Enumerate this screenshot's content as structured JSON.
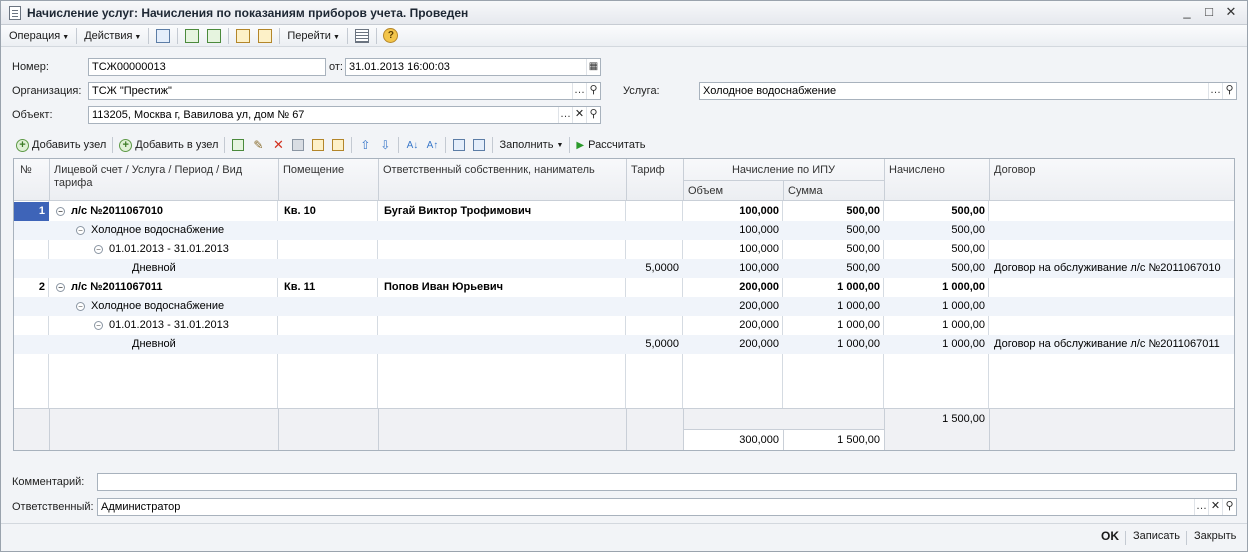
{
  "window": {
    "title": "Начисление услуг: Начисления по показаниям приборов учета. Проведен",
    "controls": [
      "_",
      "□",
      "✕"
    ]
  },
  "toolbar": {
    "operation": "Операция",
    "actions": "Действия",
    "goto": "Перейти"
  },
  "form": {
    "number_label": "Номер:",
    "number_value": "ТСЖ00000013",
    "date_label": "от:",
    "date_value": "31.01.2013 16:00:03",
    "org_label": "Организация:",
    "org_value": "ТСЖ \"Престиж\"",
    "service_label": "Услуга:",
    "service_value": "Холодное водоснабжение",
    "object_label": "Объект:",
    "object_value": "113205, Москва г, Вавилова ул, дом № 67"
  },
  "grid_toolbar": {
    "add_node": "Добавить узел",
    "add_to_node": "Добавить в узел",
    "fill": "Заполнить",
    "calculate": "Рассчитать"
  },
  "grid": {
    "headers": {
      "num": "№",
      "account": "Лицевой счет / Услуга / Период / Вид тарифа",
      "premises": "Помещение",
      "owner": "Ответственный собственник, наниматель",
      "tariff": "Тариф",
      "ipu": "Начисление по ИПУ",
      "volume": "Объем",
      "sum": "Сумма",
      "charged": "Начислено",
      "contract": "Договор"
    },
    "rows": [
      {
        "num": "1",
        "account": "л/с №2011067010",
        "premises": "Кв. 10",
        "owner": "Бугай Виктор Трофимович",
        "tariff": "",
        "volume": "100,000",
        "sum": "500,00",
        "charged": "500,00",
        "contract": ""
      },
      {
        "num": "",
        "account": "Холодное водоснабжение",
        "premises": "",
        "owner": "",
        "tariff": "",
        "volume": "100,000",
        "sum": "500,00",
        "charged": "500,00",
        "contract": ""
      },
      {
        "num": "",
        "account": "01.01.2013 - 31.01.2013",
        "premises": "",
        "owner": "",
        "tariff": "",
        "volume": "100,000",
        "sum": "500,00",
        "charged": "500,00",
        "contract": ""
      },
      {
        "num": "",
        "account": "Дневной",
        "premises": "",
        "owner": "",
        "tariff": "5,0000",
        "volume": "100,000",
        "sum": "500,00",
        "charged": "500,00",
        "contract": "Договор на обслуживание л/с №2011067010"
      },
      {
        "num": "2",
        "account": "л/с №2011067011",
        "premises": "Кв. 11",
        "owner": "Попов Иван Юрьевич",
        "tariff": "",
        "volume": "200,000",
        "sum": "1 000,00",
        "charged": "1 000,00",
        "contract": ""
      },
      {
        "num": "",
        "account": "Холодное водоснабжение",
        "premises": "",
        "owner": "",
        "tariff": "",
        "volume": "200,000",
        "sum": "1 000,00",
        "charged": "1 000,00",
        "contract": ""
      },
      {
        "num": "",
        "account": "01.01.2013 - 31.01.2013",
        "premises": "",
        "owner": "",
        "tariff": "",
        "volume": "200,000",
        "sum": "1 000,00",
        "charged": "1 000,00",
        "contract": ""
      },
      {
        "num": "",
        "account": "Дневной",
        "premises": "",
        "owner": "",
        "tariff": "5,0000",
        "volume": "200,000",
        "sum": "1 000,00",
        "charged": "1 000,00",
        "contract": "Договор на обслуживание л/с №2011067011"
      }
    ],
    "totals": {
      "charged": "1 500,00",
      "volume": "300,000",
      "sum": "1 500,00"
    }
  },
  "bottom": {
    "comment_label": "Комментарий:",
    "comment_value": "",
    "responsible_label": "Ответственный:",
    "responsible_value": "Администратор"
  },
  "buttons": {
    "ok": "OK",
    "save": "Записать",
    "close": "Закрыть"
  }
}
